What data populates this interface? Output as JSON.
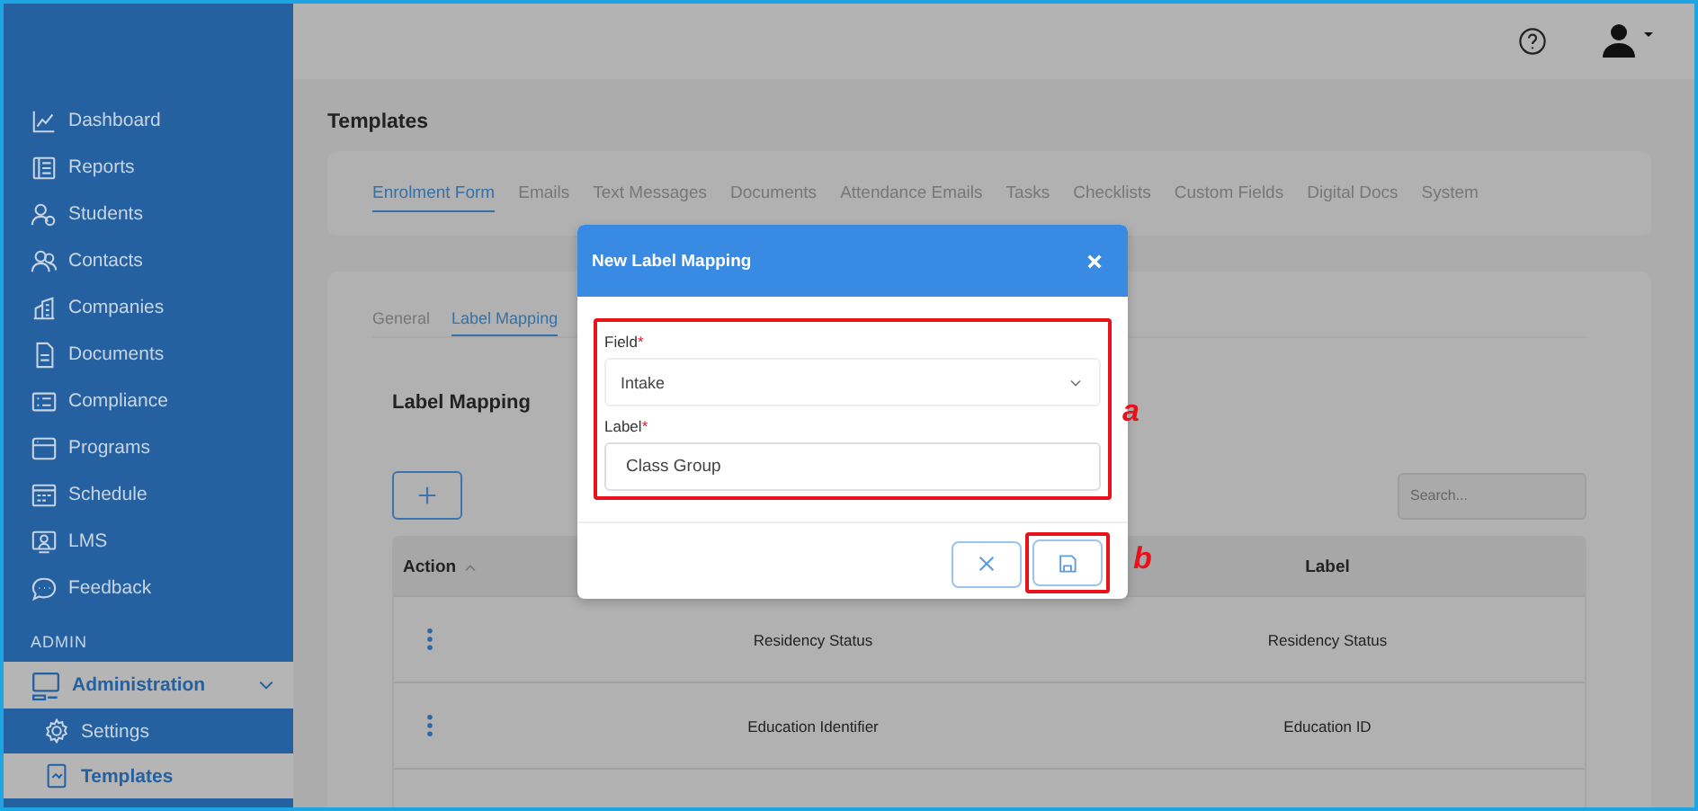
{
  "sidebar": {
    "items": [
      {
        "label": "Dashboard"
      },
      {
        "label": "Reports"
      },
      {
        "label": "Students"
      },
      {
        "label": "Contacts"
      },
      {
        "label": "Companies"
      },
      {
        "label": "Documents"
      },
      {
        "label": "Compliance"
      },
      {
        "label": "Programs"
      },
      {
        "label": "Schedule"
      },
      {
        "label": "LMS"
      },
      {
        "label": "Feedback"
      }
    ],
    "section_heading": "ADMIN",
    "admin": {
      "label": "Administration",
      "expanded": true,
      "children": [
        {
          "label": "Settings",
          "selected": false
        },
        {
          "label": "Templates",
          "selected": true
        }
      ]
    }
  },
  "page_title": "Templates",
  "tabs": [
    {
      "label": "Enrolment Form",
      "selected": true
    },
    {
      "label": "Emails",
      "selected": false
    },
    {
      "label": "Text Messages",
      "selected": false
    },
    {
      "label": "Documents",
      "selected": false
    },
    {
      "label": "Attendance Emails",
      "selected": false
    },
    {
      "label": "Tasks",
      "selected": false
    },
    {
      "label": "Checklists",
      "selected": false
    },
    {
      "label": "Custom Fields",
      "selected": false
    },
    {
      "label": "Digital Docs",
      "selected": false
    },
    {
      "label": "System",
      "selected": false
    }
  ],
  "subtabs": [
    {
      "label": "General",
      "selected": false
    },
    {
      "label": "Label Mapping",
      "selected": true
    }
  ],
  "section_title": "Label Mapping",
  "search": {
    "placeholder": "Search..."
  },
  "table": {
    "action_heading": "Action",
    "label_heading": "Label",
    "rows": [
      {
        "field": "Residency Status",
        "label": "Residency Status"
      },
      {
        "field": "Education Identifier",
        "label": "Education ID"
      }
    ]
  },
  "modal": {
    "title": "New Label Mapping",
    "fields": [
      {
        "kind": "select",
        "label": "Field",
        "required_mark": "*",
        "value": "Intake"
      },
      {
        "kind": "text",
        "label": "Label",
        "required_mark": "*",
        "value": "Class Group"
      }
    ]
  },
  "annotations": [
    {
      "letter": "a"
    },
    {
      "letter": "b"
    }
  ]
}
